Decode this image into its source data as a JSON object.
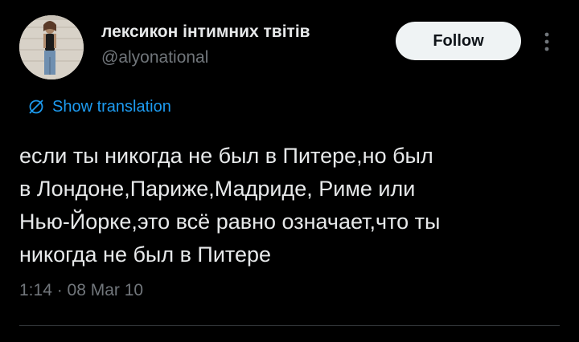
{
  "author": {
    "display_name": "лексикон інтимних твітів",
    "handle": "@alyonational",
    "avatar": "avatar-photo"
  },
  "header": {
    "follow_label": "Follow",
    "more_icon": "more-vertical-icon"
  },
  "translation": {
    "icon": "globe-icon",
    "label": "Show translation"
  },
  "tweet": {
    "text": "если ты никогда не был в Питере,но был\nв Лондоне,Париже,Мадриде, Риме или\nНью-Йорке,это всё равно означает,что ты\nникогда не был в Питере",
    "timestamp": "1:14 · 08 Mar 10"
  },
  "colors": {
    "background": "#000000",
    "text_primary": "#e7e9ea",
    "text_secondary": "#71767b",
    "link": "#1d9bf0",
    "follow_button_bg": "#eff3f4",
    "follow_button_text": "#0f1419",
    "divider": "#2f3336"
  }
}
